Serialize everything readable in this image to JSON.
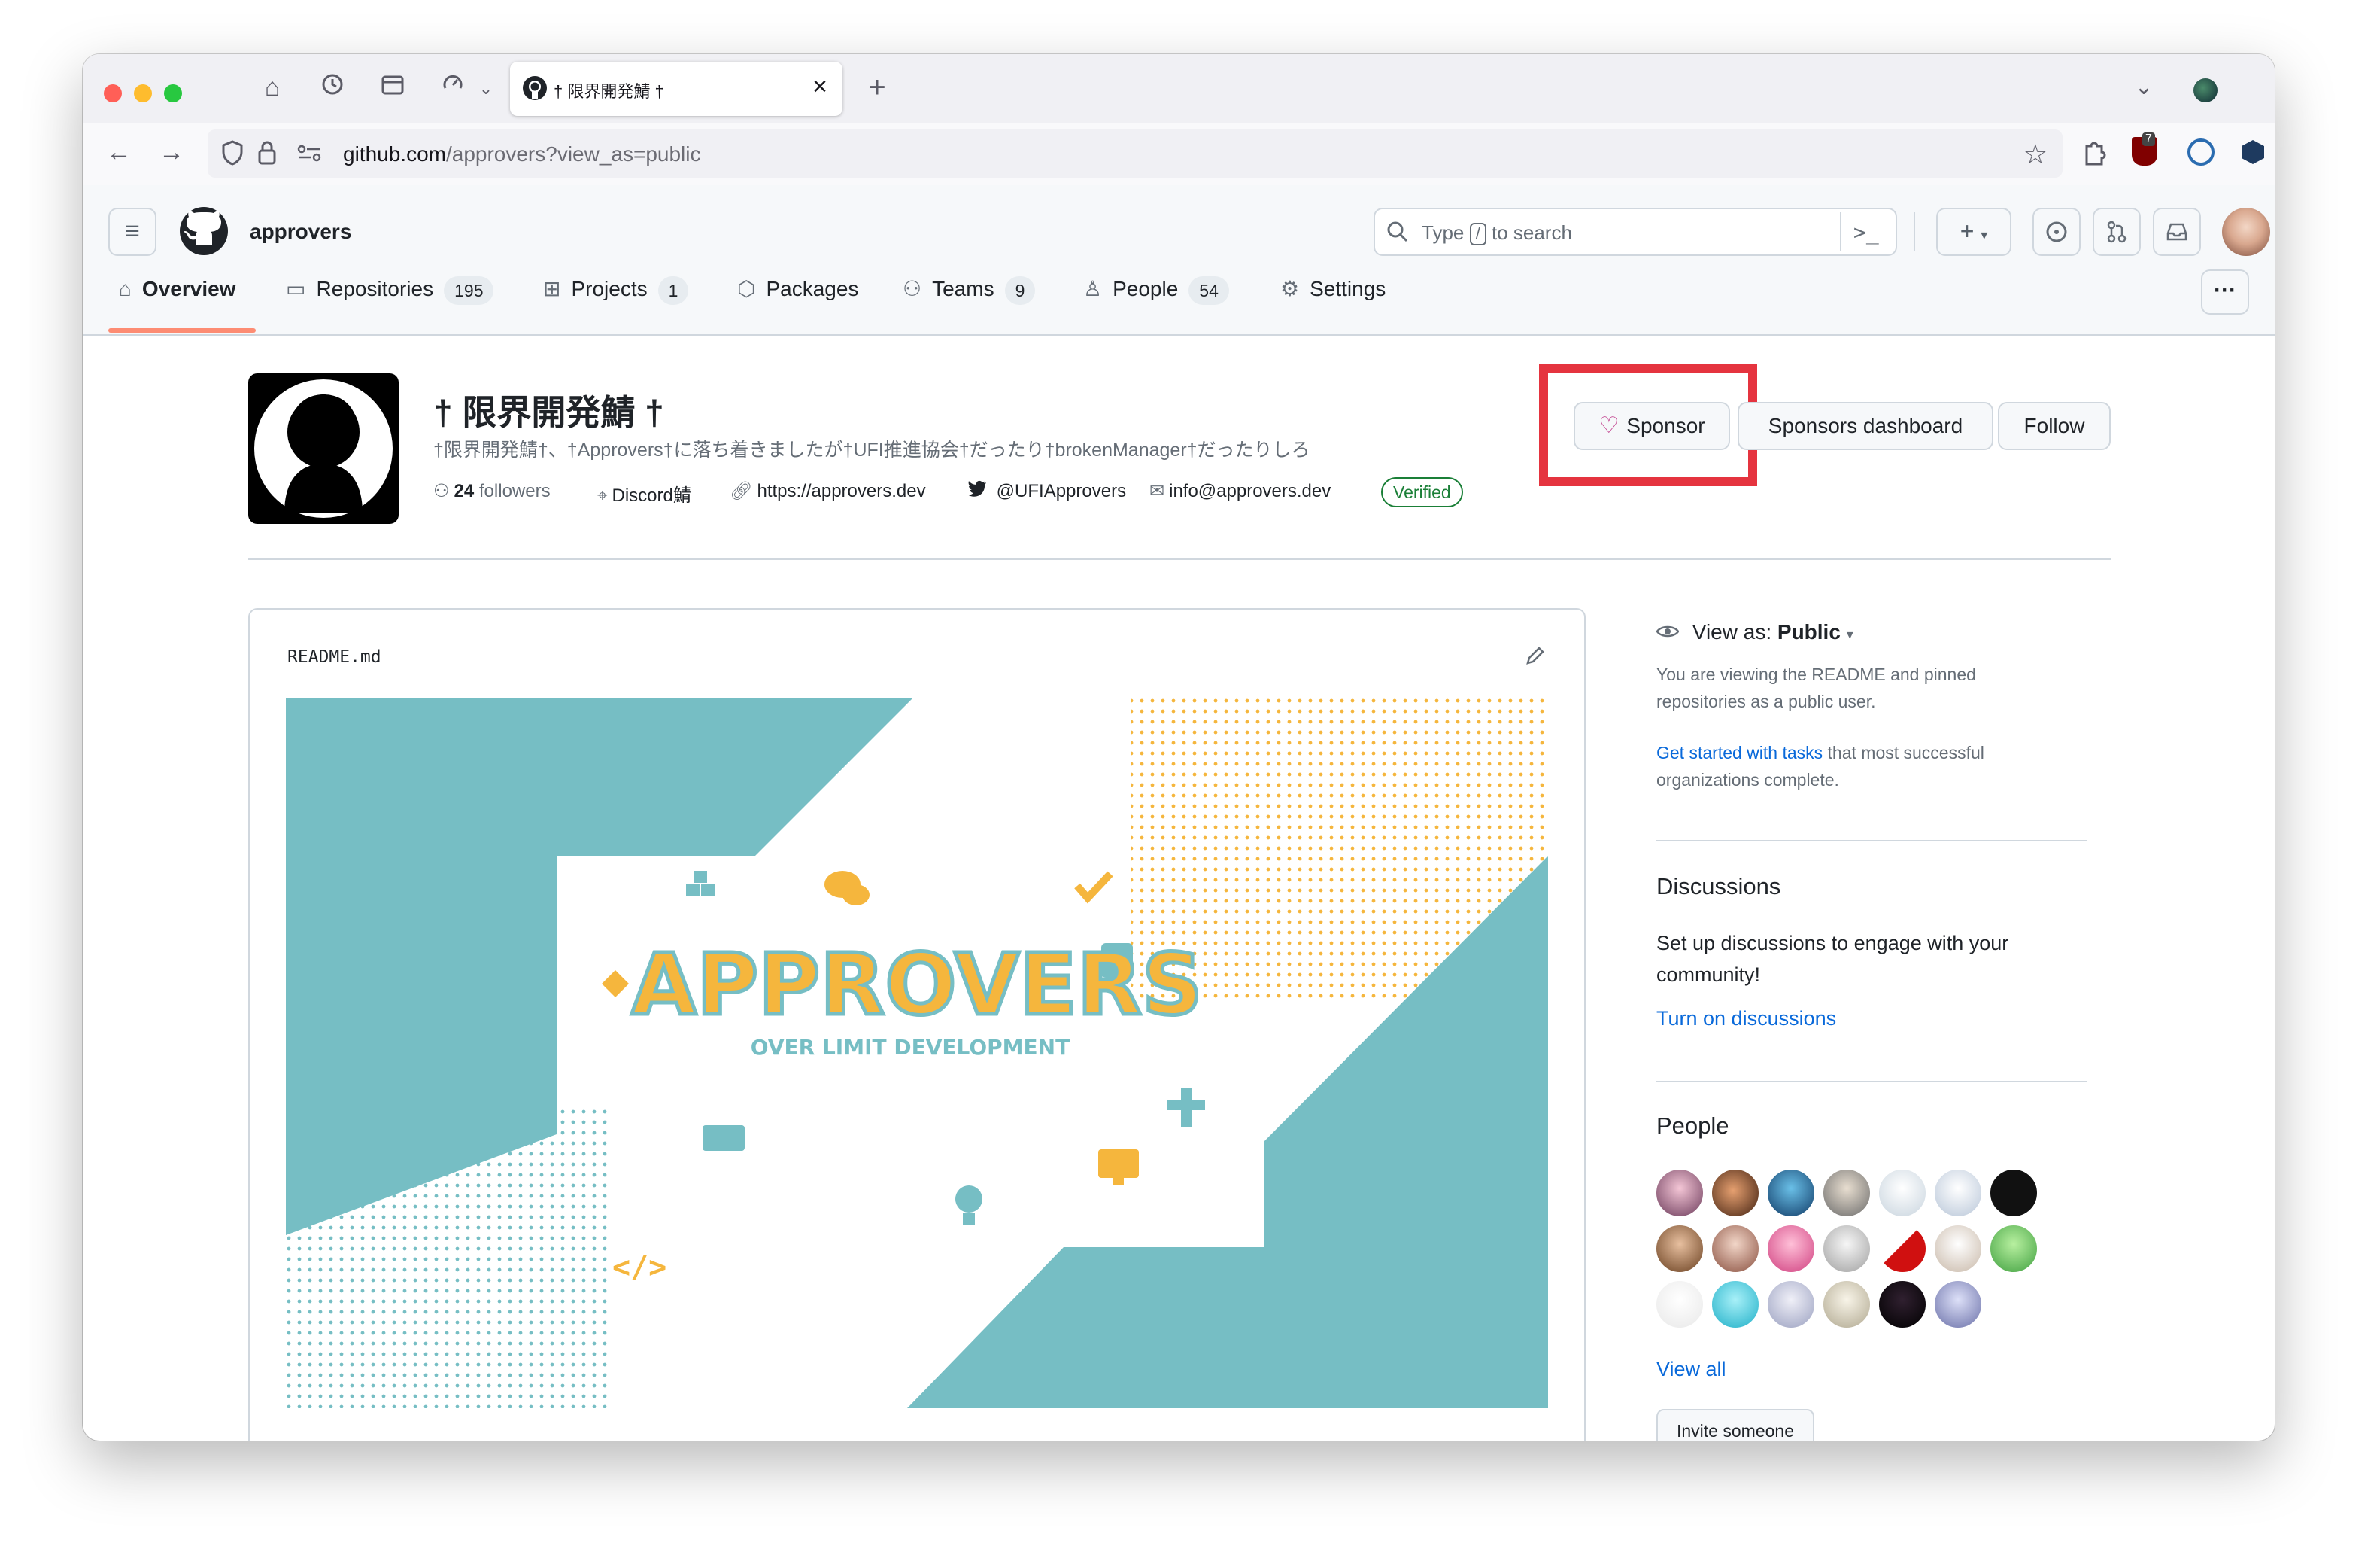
{
  "browser": {
    "tab_title": "† 限界開発鯖 †",
    "url_domain": "github.com",
    "url_path": "/approvers?view_as=public",
    "extension_badge": "7"
  },
  "header": {
    "org_name": "approvers",
    "search_prefix": "Type",
    "search_key": "/",
    "search_suffix": "to search",
    "create_plus": "+"
  },
  "nav": {
    "overview": "Overview",
    "repositories": "Repositories",
    "repositories_count": "195",
    "projects": "Projects",
    "projects_count": "1",
    "packages": "Packages",
    "teams": "Teams",
    "teams_count": "9",
    "people": "People",
    "people_count": "54",
    "settings": "Settings",
    "more": "···"
  },
  "profile": {
    "name": "† 限界開発鯖 †",
    "description": "†限界開発鯖†、†Approvers†に落ち着きましたが†UFI推進協会†だったり†brokenManager†だったりしろ",
    "followers_count": "24",
    "followers_label": "followers",
    "location": "Discord鯖",
    "website": "https://approvers.dev",
    "twitter": "@UFIApprovers",
    "email": "info@approvers.dev",
    "verified": "Verified",
    "sponsor_label": "Sponsor",
    "sponsors_dashboard_label": "Sponsors dashboard",
    "follow_label": "Follow"
  },
  "readme": {
    "filename": "README.md",
    "banner_title": "APPROVERS",
    "banner_subtitle": "OVER LIMIT DEVELOPMENT"
  },
  "sidebar": {
    "view_as_label": "View as:",
    "view_as_value": "Public",
    "view_as_desc": "You are viewing the README and pinned repositories as a public user.",
    "get_started_link": "Get started with tasks",
    "get_started_rest": "that most successful organizations complete.",
    "discussions_title": "Discussions",
    "discussions_desc": "Set up discussions to engage with your community!",
    "discussions_link": "Turn on discussions",
    "people_title": "People",
    "view_all": "View all",
    "invite_label": "Invite someone"
  },
  "colors": {
    "accent_blue": "#0969da",
    "sponsor_heart": "#bf3989",
    "highlight_red": "#e5343f",
    "banner_teal": "#76bec4",
    "banner_yellow": "#f5b63d",
    "verified_green": "#1a7f37"
  }
}
